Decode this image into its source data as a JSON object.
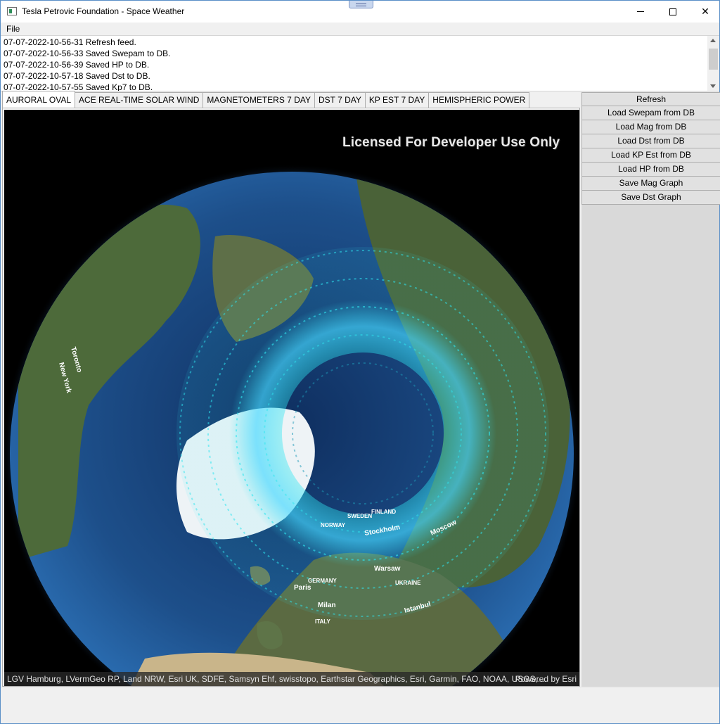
{
  "window": {
    "title": "Tesla Petrovic Foundation - Space Weather",
    "controls": {
      "minimize": "minimize",
      "maximize": "maximize",
      "close": "close"
    }
  },
  "menu": {
    "file": "File"
  },
  "log": {
    "lines": [
      "07-07-2022-10-56-31 Refresh feed.",
      "07-07-2022-10-56-33 Saved Swepam to DB.",
      "07-07-2022-10-56-39 Saved HP to DB.",
      "07-07-2022-10-57-18 Saved Dst to DB.",
      "07-07-2022-10-57-55 Saved Kp7 to DB."
    ]
  },
  "tabs": [
    {
      "label": "AURORAL OVAL",
      "active": true
    },
    {
      "label": "ACE REAL-TIME SOLAR WIND",
      "active": false
    },
    {
      "label": "MAGNETOMETERS 7 DAY",
      "active": false
    },
    {
      "label": "DST 7 DAY",
      "active": false
    },
    {
      "label": "KP EST 7 DAY",
      "active": false
    },
    {
      "label": "HEMISPHERIC POWER",
      "active": false
    }
  ],
  "map": {
    "license": "Licensed For Developer Use Only",
    "attribution": "LGV Hamburg, LVermGeo RP, Land NRW, Esri UK, SDFE, Samsyn Ehf, swisstopo, Earthstar Geographics, Esri, Garmin, FAO, NOAA, USGS,...",
    "powered_by": "Powered by Esri",
    "labels": [
      "Toronto",
      "New York",
      "Stockholm",
      "Moscow",
      "SWEDEN",
      "FINLAND",
      "NORWAY",
      "Warsaw",
      "UKRAINE",
      "GERMANY",
      "Paris",
      "Milan",
      "ITALY",
      "Istanbul"
    ]
  },
  "actions": [
    "Refresh",
    "Load Swepam from DB",
    "Load Mag from DB",
    "Load Dst from DB",
    "Load KP Est from DB",
    "Load HP from DB",
    "Save Mag Graph",
    "Save Dst Graph"
  ],
  "colors": {
    "accent_border": "#5a8fc7",
    "aurora": "#2ee6f0",
    "ocean": "#1d4f8a"
  }
}
